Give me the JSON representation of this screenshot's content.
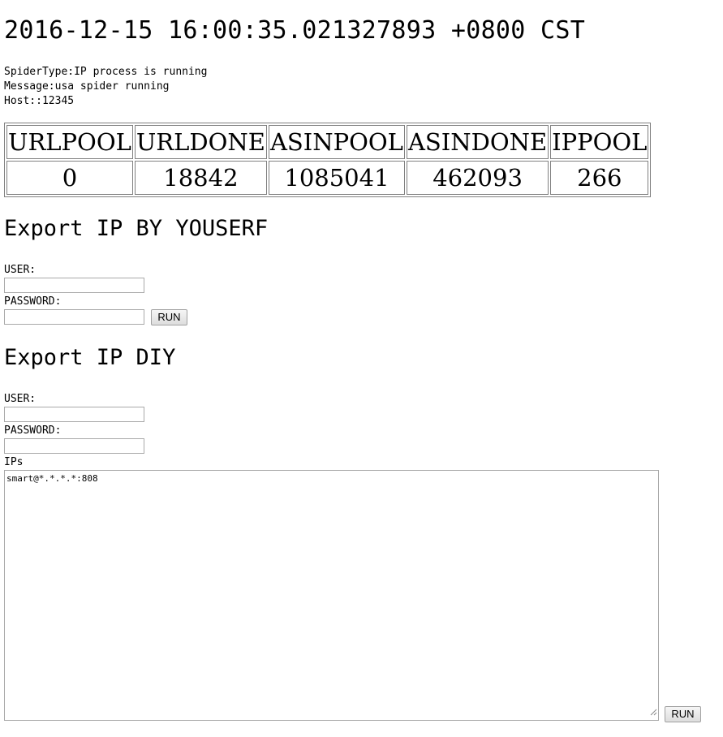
{
  "header": {
    "timestamp": "2016-12-15 16:00:35.021327893 +0800 CST"
  },
  "info": {
    "spider_type": "SpiderType:IP process is running",
    "message": "Message:usa spider running",
    "host": "Host::12345"
  },
  "stats_table": {
    "headers": [
      "URLPOOL",
      "URLDONE",
      "ASINPOOL",
      "ASINDONE",
      "IPPOOL"
    ],
    "values": [
      "0",
      "18842",
      "1085041",
      "462093",
      "266"
    ]
  },
  "export_yourself": {
    "title": "Export IP BY YOUSERF",
    "user_label": "USER:",
    "user_value": "",
    "password_label": "PASSWORD:",
    "password_value": "",
    "run_label": "RUN"
  },
  "export_diy": {
    "title": "Export IP DIY",
    "user_label": "USER:",
    "user_value": "",
    "password_label": "PASSWORD:",
    "password_value": "",
    "ips_label": "IPs",
    "ips_value": "smart@*.*.*.*:808",
    "run_label": "RUN"
  }
}
